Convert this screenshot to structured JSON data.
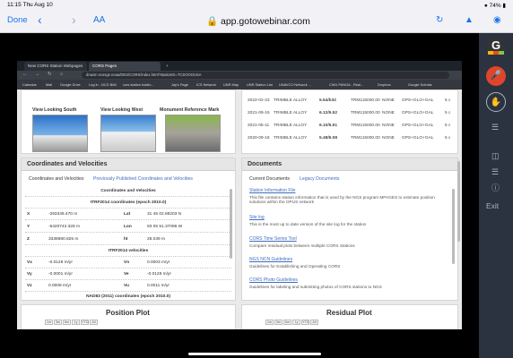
{
  "ios_status": {
    "time_date": "11:15  Thu Aug 10",
    "right": "74%"
  },
  "safari": {
    "done": "Done",
    "back_icon": "chevron-left",
    "forward_icon": "chevron-right",
    "text_size": "AA",
    "url": "app.gotowebinar.com"
  },
  "goto_panel": {
    "logo_letter": "G",
    "exit": "Exit"
  },
  "browser": {
    "tabs": [
      {
        "label": "New CORS Station Webpages - ..."
      },
      {
        "label": "CORS Pages"
      }
    ],
    "url": "dnavtn.ncssgs.noaa/DES/CORS/index.html?stationID=TCSOOOUSA",
    "bookmarks": [
      "Calendar",
      "Mail",
      "Google Drive",
      "Log in - NCG BIM",
      "cors station holdin...",
      "Jay's Page",
      "ICS Network",
      "UNR Map",
      "UNR Station List",
      "UNAVCO Network ...",
      "CWU PANGA - Real...",
      "Dropbox",
      "Google Scholar"
    ]
  },
  "photos": {
    "south": "View Looking South",
    "west": "View Looking West",
    "monument": "Monument Reference Mark"
  },
  "equipment_table": {
    "rows": [
      {
        "date": "2022-02-23",
        "receiver": "TRIMBLE ALLOY",
        "fw": "5.54/b32",
        "ant": "TRM115000.00",
        "radome": "NONE",
        "sys": "GPS+GLO+GAL",
        "r": "5 c"
      },
      {
        "date": "2021-09-15",
        "receiver": "TRIMBLE ALLOY",
        "fw": "6.12/5.52",
        "ant": "TRM115000.00",
        "radome": "NONE",
        "sys": "GPS+GLO+GAL",
        "r": "5 c"
      },
      {
        "date": "2021-05-11",
        "receiver": "TRIMBLE ALLOY",
        "fw": "6.10/5.51",
        "ant": "TRM115000.00",
        "radome": "NONE",
        "sys": "GPS+GLO+GAL",
        "r": "5 c"
      },
      {
        "date": "2020-09-18",
        "receiver": "TRIMBLE ALLOY",
        "fw": "5.48/6.08",
        "ant": "TRM115000.00",
        "radome": "NONE",
        "sys": "GPS+GLO+GAL",
        "r": "5 c"
      }
    ]
  },
  "coords": {
    "title": "Coordinates and Velocities",
    "tab1": "Coordinates and Velocities",
    "tab2": "Previously Published Coordinates and Velocities",
    "subtitle": "Coordinates and Velocities",
    "itrf_head": "ITRF2014 coordinates (epoch 2010.0)",
    "x_label": "X",
    "x_val": "-293349.470 m",
    "y_label": "Y",
    "y_val": "-5420742.328 m",
    "z_label": "Z",
    "z_val": "3336980.825 m",
    "lat_label": "Lat",
    "lat_val": "31 45 02.88203 N",
    "lon_label": "Lon",
    "lon_val": "93 05 51.37096 W",
    "ht_label": "ht",
    "ht_val": "28.039 m",
    "vel_head": "ITRF2014 velocities",
    "vx_label": "Vx",
    "vx_val": "-0.0128 m/yr",
    "vy_label": "Vy",
    "vy_val": "-0.0001 m/yr",
    "vz_label": "Vz",
    "vz_val": "0.0008 m/yr",
    "vn_label": "Vn",
    "vn_val": "0.0003 m/yr",
    "ve_label": "Ve",
    "ve_val": "-0.0128 m/yr",
    "vu_label": "Vu",
    "vu_val": "0.0011 m/yr",
    "nad_head": "NAD83 (2011) coordinates (epoch 2010.0)"
  },
  "documents": {
    "title": "Documents",
    "tab1": "Current Documents",
    "tab2": "Legacy Documents",
    "items": [
      {
        "link": "Station Information File",
        "desc": "This file contains station information that is used by the NGS program MPAGES to estimate position solutions within the OPUS network"
      },
      {
        "link": "Site log",
        "desc": "This is the most up to date version of the site log for the station"
      },
      {
        "link": "CORS Time Series Tool",
        "desc": "Compare residual plots between multiple CORS Stations"
      },
      {
        "link": "NGS NCN Guidelines",
        "desc": "Guidelines for Establishing and Operating CORS"
      },
      {
        "link": "CORS Photo Guidelines",
        "desc": "Guidelines for labeling and submitting photos of CORS stations to NGS"
      }
    ]
  },
  "plots": {
    "position": "Position Plot",
    "residual": "Residual Plot",
    "ranges": [
      "1m",
      "3m",
      "6m",
      "1y",
      "YTD",
      "All"
    ]
  }
}
